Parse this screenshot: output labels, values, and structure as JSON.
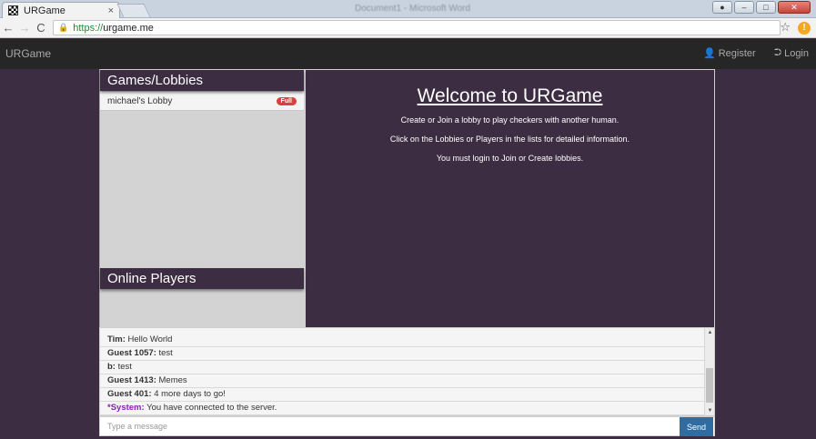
{
  "browser": {
    "tab_title": "URGame",
    "tab_close": "×",
    "window_title": "Document1 - Microsoft Word",
    "url_scheme": "https://",
    "url_host": "urgame.me",
    "back_icon": "←",
    "forward_icon": "→",
    "reload_icon": "C",
    "star_icon": "☆",
    "extension_icon": "!"
  },
  "navbar": {
    "brand": "URGame",
    "register_label": "Register",
    "login_label": "Login"
  },
  "games_panel": {
    "title": "Games/Lobbies",
    "lobbies": [
      {
        "name": "michael's Lobby",
        "status": "Full"
      }
    ]
  },
  "players_panel": {
    "title": "Online Players"
  },
  "welcome": {
    "title": "Welcome to URGame",
    "line1": "Create or Join a lobby to play checkers with another human.",
    "line2": "Click on the Lobbies or Players in the lists for detailed information.",
    "line3": "You must login to Join or Create lobbies."
  },
  "chat": {
    "messages": [
      {
        "author": "Tim:",
        "text": " Hello World"
      },
      {
        "author": "Guest 1057:",
        "text": " test"
      },
      {
        "author": "b:",
        "text": " test"
      },
      {
        "author": "Guest 1413:",
        "text": " Memes"
      },
      {
        "author": "Guest 401:",
        "text": " 4 more days to go!"
      },
      {
        "author": "*System:",
        "text": " You have connected to the server."
      }
    ],
    "input_placeholder": "Type a message",
    "send_label": "Send"
  }
}
